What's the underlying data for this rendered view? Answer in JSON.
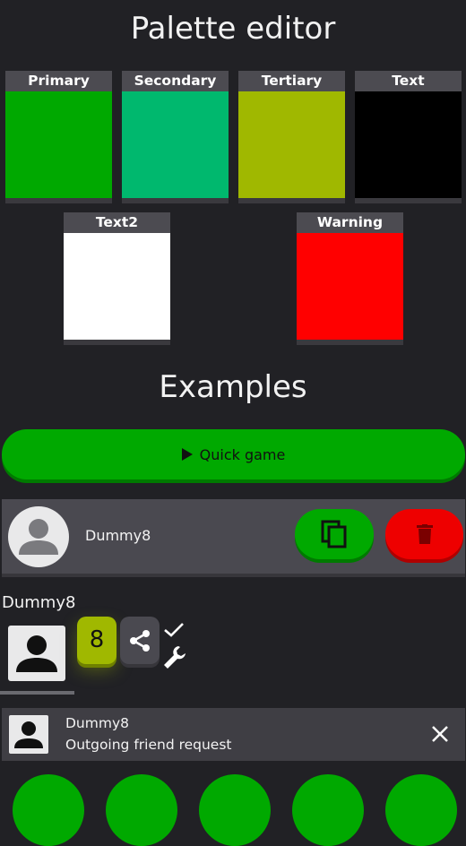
{
  "header": {
    "title": "Palette editor"
  },
  "palette": [
    {
      "label": "Primary",
      "color": "#00a900"
    },
    {
      "label": "Secondary",
      "color": "#00b86e"
    },
    {
      "label": "Tertiary",
      "color": "#a0b800"
    },
    {
      "label": "Text",
      "color": "#000000"
    },
    {
      "label": "Text2",
      "color": "#ffffff"
    },
    {
      "label": "Warning",
      "color": "#ff0000"
    }
  ],
  "examples": {
    "title": "Examples",
    "quick_game": {
      "label": "Quick game",
      "icon": "play-icon"
    },
    "player_card": {
      "name": "Dummy8",
      "avatar_icon": "person-icon",
      "copy_icon": "copy-icon",
      "delete_icon": "trash-icon"
    },
    "user_tile": {
      "name": "Dummy8",
      "level": "8",
      "share_icon": "share-icon",
      "check_icon": "check-icon",
      "wrench_icon": "wrench-icon"
    },
    "notification": {
      "name": "Dummy8",
      "message": "Outgoing friend request",
      "close_icon": "close-icon"
    }
  }
}
